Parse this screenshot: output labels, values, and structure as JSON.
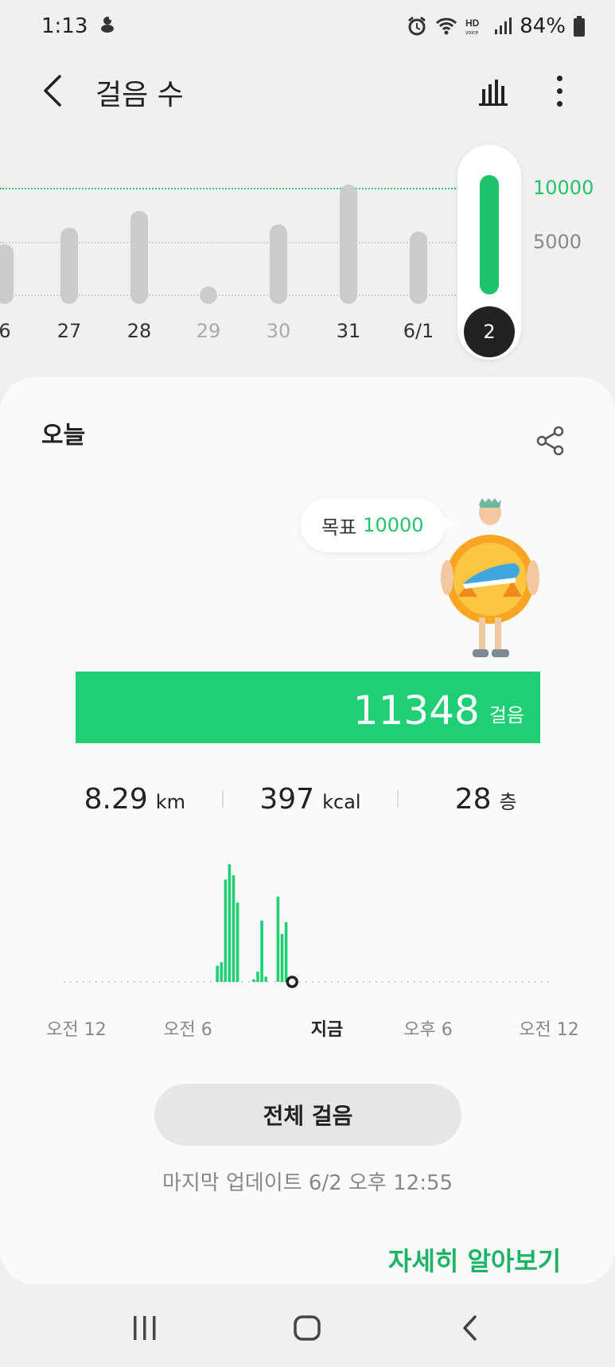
{
  "status_bar": {
    "time": "1:13",
    "battery": "84%",
    "icons": [
      "pet-notification-icon",
      "alarm-icon",
      "wifi-icon",
      "hd-voice-icon",
      "signal-icon",
      "battery-icon"
    ]
  },
  "header": {
    "title": "걸음 수",
    "icons": [
      "back-arrow-icon",
      "bar-chart-icon",
      "more-vert-icon"
    ]
  },
  "weekly_chart": {
    "goal_label": "10000",
    "mid_label": "5000",
    "days": [
      {
        "label": "6",
        "steps": 5600,
        "dim": false
      },
      {
        "label": "27",
        "steps": 7200,
        "dim": false
      },
      {
        "label": "28",
        "steps": 8700,
        "dim": false
      },
      {
        "label": "29",
        "steps": 600,
        "dim": true
      },
      {
        "label": "30",
        "steps": 7500,
        "dim": true
      },
      {
        "label": "31",
        "steps": 12700,
        "dim": false
      },
      {
        "label": "6/1",
        "steps": 6800,
        "dim": false
      }
    ],
    "selected": {
      "label": "2",
      "steps": 11348
    },
    "colors": {
      "goal": "#23c26b",
      "bar": "#cbcbcb",
      "selected": "#1dc46c"
    }
  },
  "card": {
    "today_label": "오늘",
    "goal_text": "목표",
    "goal_value": "10000",
    "steps_value": "11348",
    "steps_unit": "걸음",
    "stats": [
      {
        "value": "8.29",
        "unit": "km"
      },
      {
        "value": "397",
        "unit": "kcal"
      },
      {
        "value": "28",
        "unit": "층"
      }
    ],
    "time_labels": [
      "오전 12",
      "오전 6",
      "지금",
      "오후 6",
      "오전 12"
    ],
    "hourly_steps": [
      {
        "hour": 7.6,
        "value": 190
      },
      {
        "hour": 7.8,
        "value": 230
      },
      {
        "hour": 8.0,
        "value": 1200
      },
      {
        "hour": 8.2,
        "value": 1380
      },
      {
        "hour": 8.4,
        "value": 1250
      },
      {
        "hour": 8.6,
        "value": 930
      },
      {
        "hour": 9.4,
        "value": 30
      },
      {
        "hour": 9.6,
        "value": 120
      },
      {
        "hour": 9.8,
        "value": 720
      },
      {
        "hour": 10.0,
        "value": 60
      },
      {
        "hour": 10.6,
        "value": 1000
      },
      {
        "hour": 10.8,
        "value": 560
      },
      {
        "hour": 11.0,
        "value": 700
      }
    ],
    "now_hour": 11.3,
    "all_steps_button": "전체 걸음",
    "last_update": "마지막 업데이트 6/2 오후 12:55",
    "learn_more": "자세히 알아보기",
    "colors": {
      "bar": "#1fcf73",
      "accent": "#1db365"
    }
  },
  "nav_bar": {
    "icons": [
      "recent-apps-icon",
      "home-icon",
      "back-icon"
    ]
  }
}
